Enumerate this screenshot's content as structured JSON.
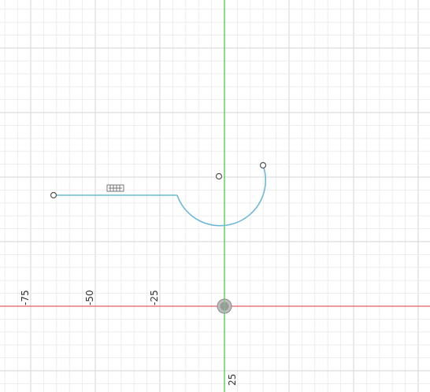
{
  "viewport": {
    "grid_minor_color": "#e9e9e9",
    "grid_major_color": "#d6d6d6",
    "x_axis_color": "#e06060",
    "y_axis_color": "#3cc83c",
    "sketch_color": "#6fb8d8",
    "point_color": "#555555"
  },
  "axis_labels": {
    "x_neg_75": "-75",
    "x_neg_50": "-50",
    "x_neg_25": "-25",
    "y_25": "25"
  },
  "sketch": {
    "entities": [
      "line",
      "arc"
    ],
    "constraint_icon": "horizontal-constraint-icon",
    "points": [
      "line-endpoint",
      "arc-center",
      "arc-endpoint"
    ]
  },
  "origin_icon": "origin-icon"
}
